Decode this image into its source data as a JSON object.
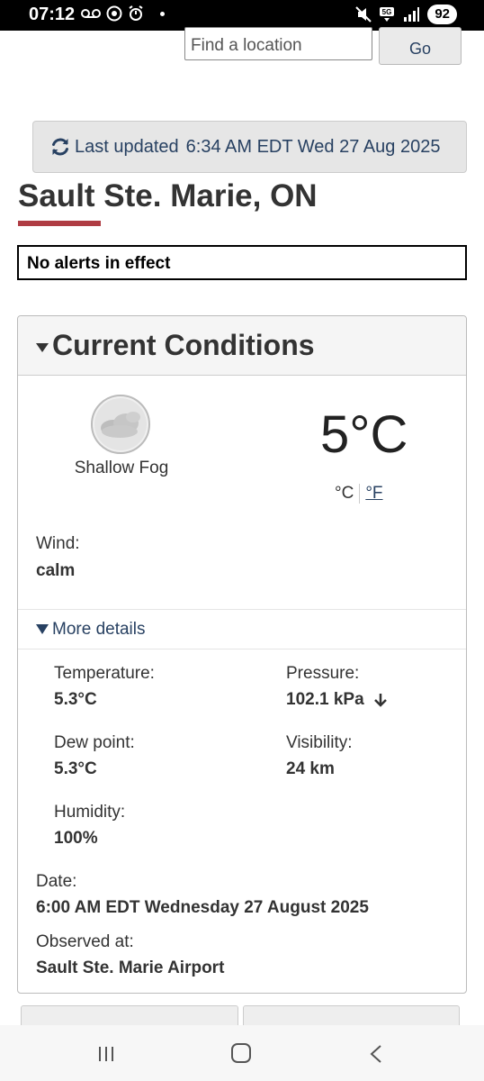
{
  "status_bar": {
    "time": "07:12",
    "battery": "92",
    "network": "5G"
  },
  "search": {
    "placeholder": "Find a location",
    "go_label": "Go"
  },
  "last_updated": {
    "label": "Last updated",
    "value": "6:34 AM EDT Wed 27 Aug 2025"
  },
  "city": {
    "name": "Sault Ste. Marie, ON"
  },
  "alerts": {
    "text": "No alerts in effect"
  },
  "current_conditions": {
    "title": "Current Conditions",
    "condition": "Shallow Fog",
    "temperature": "5°C",
    "unit_c": "°C",
    "unit_f": "°F",
    "wind_label": "Wind:",
    "wind_value": "calm",
    "more_details_label": "More details",
    "details": {
      "temperature_label": "Temperature:",
      "temperature_value": "5.3°C",
      "pressure_label": "Pressure:",
      "pressure_value": "102.1 kPa",
      "dew_point_label": "Dew point:",
      "dew_point_value": "5.3°C",
      "visibility_label": "Visibility:",
      "visibility_value": "24 km",
      "humidity_label": "Humidity:",
      "humidity_value": "100%"
    },
    "date_label": "Date:",
    "date_value": "6:00 AM EDT Wednesday 27 August 2025",
    "observed_label": "Observed at:",
    "observed_value": "Sault Ste. Marie Airport"
  },
  "colors": {
    "link_blue": "#284162",
    "accent_red": "#af3c43"
  }
}
